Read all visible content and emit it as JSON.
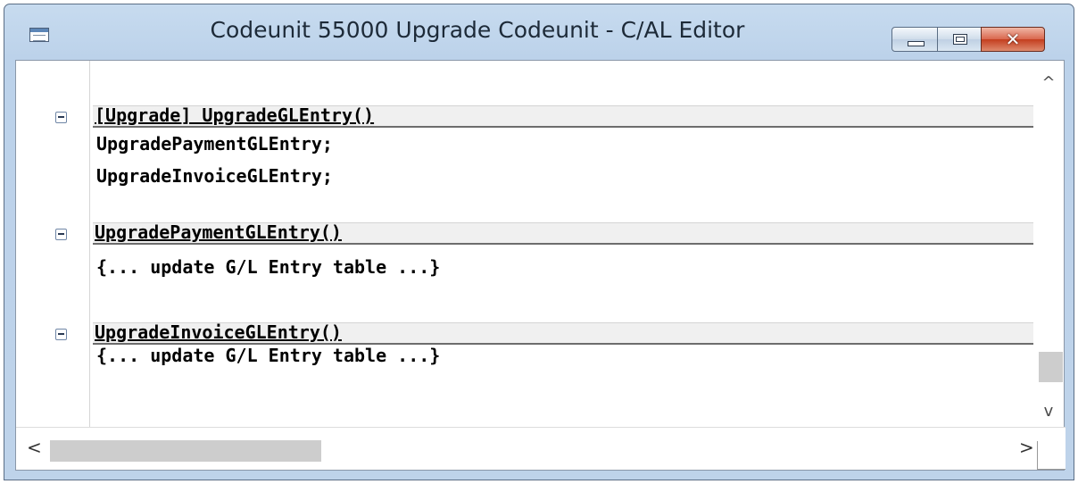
{
  "window": {
    "title": "Codeunit 55000 Upgrade Codeunit - C/AL Editor",
    "close_glyph": "✕"
  },
  "editor": {
    "sections": [
      {
        "header": "[Upgrade] UpgradeGLEntry()",
        "lines": [
          "UpgradePaymentGLEntry;",
          "UpgradeInvoiceGLEntry;"
        ]
      },
      {
        "header": "UpgradePaymentGLEntry()",
        "lines": [
          "{... update G/L Entry table ...}"
        ]
      },
      {
        "header": "UpgradeInvoiceGLEntry()",
        "lines": [
          "{... update G/L Entry table ...}"
        ]
      }
    ]
  },
  "scrollbars": {
    "up_arrow": "^",
    "down_arrow": "v",
    "left_arrow": "<",
    "right_arrow": ">"
  }
}
